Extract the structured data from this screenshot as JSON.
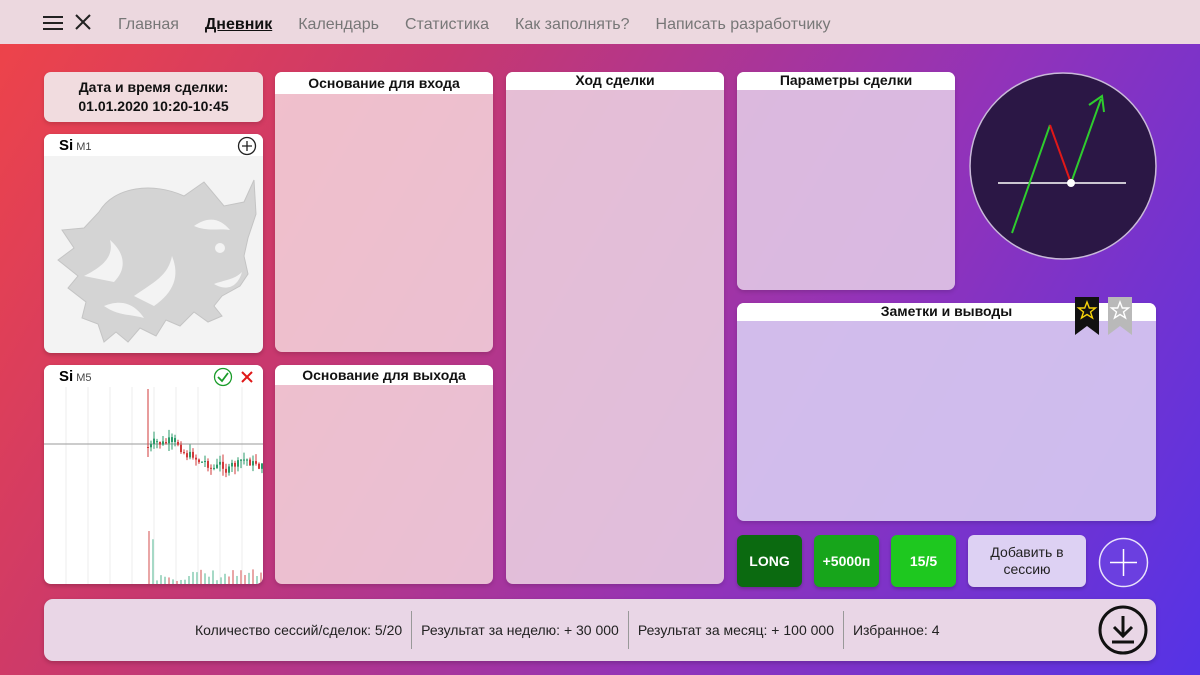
{
  "nav": {
    "items": [
      {
        "label": "Главная",
        "active": false
      },
      {
        "label": "Дневник",
        "active": true
      },
      {
        "label": "Календарь",
        "active": false
      },
      {
        "label": "Статистика",
        "active": false
      },
      {
        "label": "Как заполнять?",
        "active": false
      },
      {
        "label": "Написать разработчику",
        "active": false
      }
    ]
  },
  "deal": {
    "date_label": "Дата и время сделки:",
    "date_value": "01.01.2020 10:20-10:45"
  },
  "charts": [
    {
      "ticker": "Si",
      "timeframe": "M1",
      "icon": "plus-circle-icon"
    },
    {
      "ticker": "Si",
      "timeframe": "M5",
      "icons": [
        "check-circle-icon",
        "close-red-icon"
      ]
    }
  ],
  "panels": {
    "entry_reason": "Основание для входа",
    "exit_reason": "Основание для выхода",
    "deal_progress": "Ход сделки",
    "deal_params": "Параметры сделки",
    "notes": "Заметки и выводы"
  },
  "stats": {
    "direction": "LONG",
    "result": "+5000п",
    "ratio": "15/5",
    "add_session": "Добавить в сессию"
  },
  "footer": {
    "sessions": "Количество сессий/сделок: 5/20",
    "week": "Результат за неделю: + 30 000",
    "month": "Результат за месяц: + 100 000",
    "favorites": "Избранное: 4"
  },
  "colors": {
    "long_bg": "#0b6a10",
    "result_bg": "#17a51b",
    "ratio_bg": "#1ec81f",
    "clock_bg": "#2a1640"
  }
}
